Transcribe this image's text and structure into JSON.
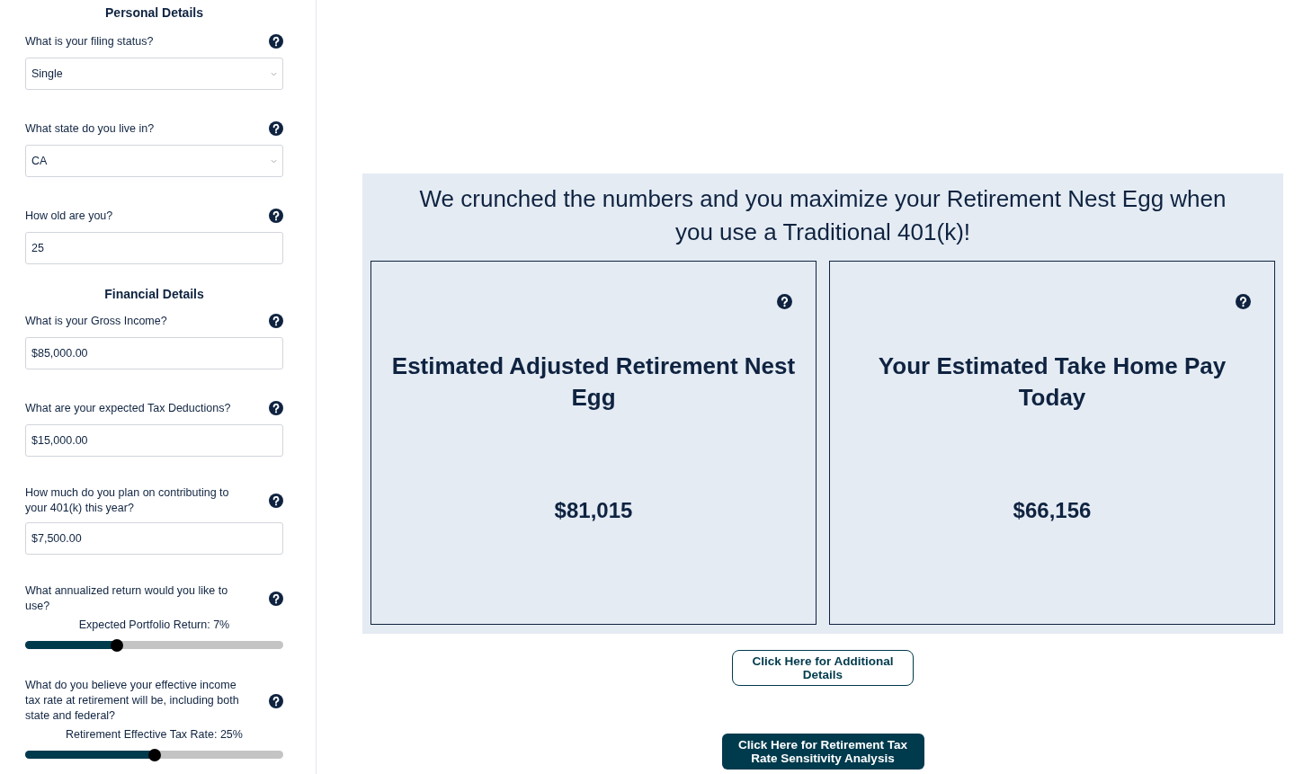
{
  "sidebar": {
    "sections": [
      {
        "title": "Personal Details",
        "fields": [
          {
            "kind": "select",
            "label": "What is your filing status?",
            "value": "Single"
          },
          {
            "kind": "select",
            "label": "What state do you live in?",
            "value": "CA"
          },
          {
            "kind": "input",
            "label": "How old are you?",
            "value": "25"
          }
        ]
      },
      {
        "title": "Financial Details",
        "fields": [
          {
            "kind": "input",
            "label": "What is your Gross Income?",
            "value": "$85,000.00"
          },
          {
            "kind": "input",
            "label": "What are your expected Tax Deductions?",
            "value": "$15,000.00"
          },
          {
            "kind": "input",
            "label": "How much do you plan on contributing to your 401(k) this year?",
            "value": "$7,500.00"
          },
          {
            "kind": "slider",
            "label": "What annualized return would you like to use?",
            "caption": "Expected Portfolio Return: 7%",
            "level": 0.355
          },
          {
            "kind": "slider",
            "label": "What do you believe your effective income tax rate at retirement will be, including both state and federal?",
            "caption": "Retirement Effective Tax Rate: 25%",
            "level": 0.5
          }
        ]
      }
    ]
  },
  "result": {
    "headline": "We crunched the numbers and you maximize your Retirement Nest Egg when you use a Traditional 401(k)!",
    "cards": [
      {
        "title": "Estimated Adjusted Retirement Nest Egg",
        "value": "$81,015"
      },
      {
        "title": "Your Estimated Take Home Pay Today",
        "value": "$66,156"
      }
    ]
  },
  "buttons": [
    {
      "kind": "outline",
      "label": "Click Here for Additional Details"
    },
    {
      "kind": "filled",
      "label": "Click Here for Retirement Tax Rate Sensitivity Analysis"
    }
  ]
}
